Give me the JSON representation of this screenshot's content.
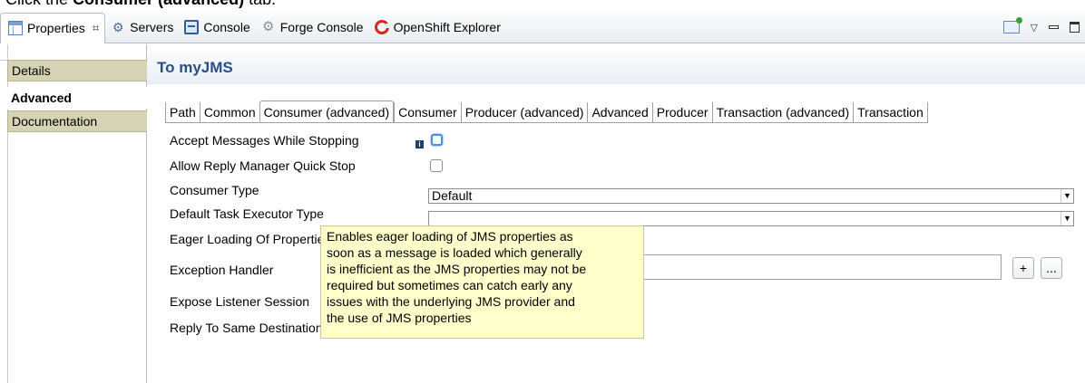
{
  "caption": {
    "prefix": "Click the ",
    "bold": "Consumer (advanced)",
    "suffix": " tab."
  },
  "view_tabs": [
    {
      "label": "Properties",
      "icon": "properties-icon",
      "active": true,
      "close": "⌗"
    },
    {
      "label": "Servers",
      "icon": "servers-icon"
    },
    {
      "label": "Console",
      "icon": "console-icon"
    },
    {
      "label": "Forge Console",
      "icon": "forge-icon"
    },
    {
      "label": "OpenShift Explorer",
      "icon": "openshift-icon"
    }
  ],
  "view_actions": {
    "menu": "▽"
  },
  "sidebar": {
    "items": [
      {
        "label": "Details"
      },
      {
        "label": "Advanced"
      },
      {
        "label": "Documentation"
      }
    ]
  },
  "header": {
    "title": "To myJMS"
  },
  "property_tabs": [
    {
      "label": "Path"
    },
    {
      "label": "Common"
    },
    {
      "label": "Consumer (advanced)",
      "active": true
    },
    {
      "label": "Consumer"
    },
    {
      "label": "Producer (advanced)"
    },
    {
      "label": "Advanced"
    },
    {
      "label": "Producer"
    },
    {
      "label": "Transaction (advanced)"
    },
    {
      "label": "Transaction"
    }
  ],
  "fields": {
    "accept_messages": {
      "label": "Accept Messages While Stopping",
      "info": "i",
      "checked": false
    },
    "allow_reply": {
      "label": "Allow Reply Manager Quick Stop",
      "checked": false
    },
    "consumer_type": {
      "label": "Consumer Type",
      "value": "Default",
      "arrow": "▼"
    },
    "default_task": {
      "label": "Default Task Executor Type",
      "value": "",
      "arrow": "▼"
    },
    "eager_loading": {
      "label": "Eager Loading Of Properties",
      "checked": true
    },
    "exception_handler": {
      "label": "Exception Handler",
      "value": "",
      "add_label": "+",
      "browse_label": "..."
    },
    "expose_listener": {
      "label": "Expose Listener Session",
      "checked": true
    },
    "reply_same_dest": {
      "label": "Reply To Same Destination Allowed",
      "checked": false
    }
  },
  "tooltip": {
    "lines": [
      "Enables eager loading of JMS properties as",
      "soon as a message is loaded which generally",
      "is inefficient as the JMS properties may not be",
      "required but sometimes can catch early any",
      "issues with the underlying JMS provider and",
      "the use of JMS properties"
    ]
  }
}
